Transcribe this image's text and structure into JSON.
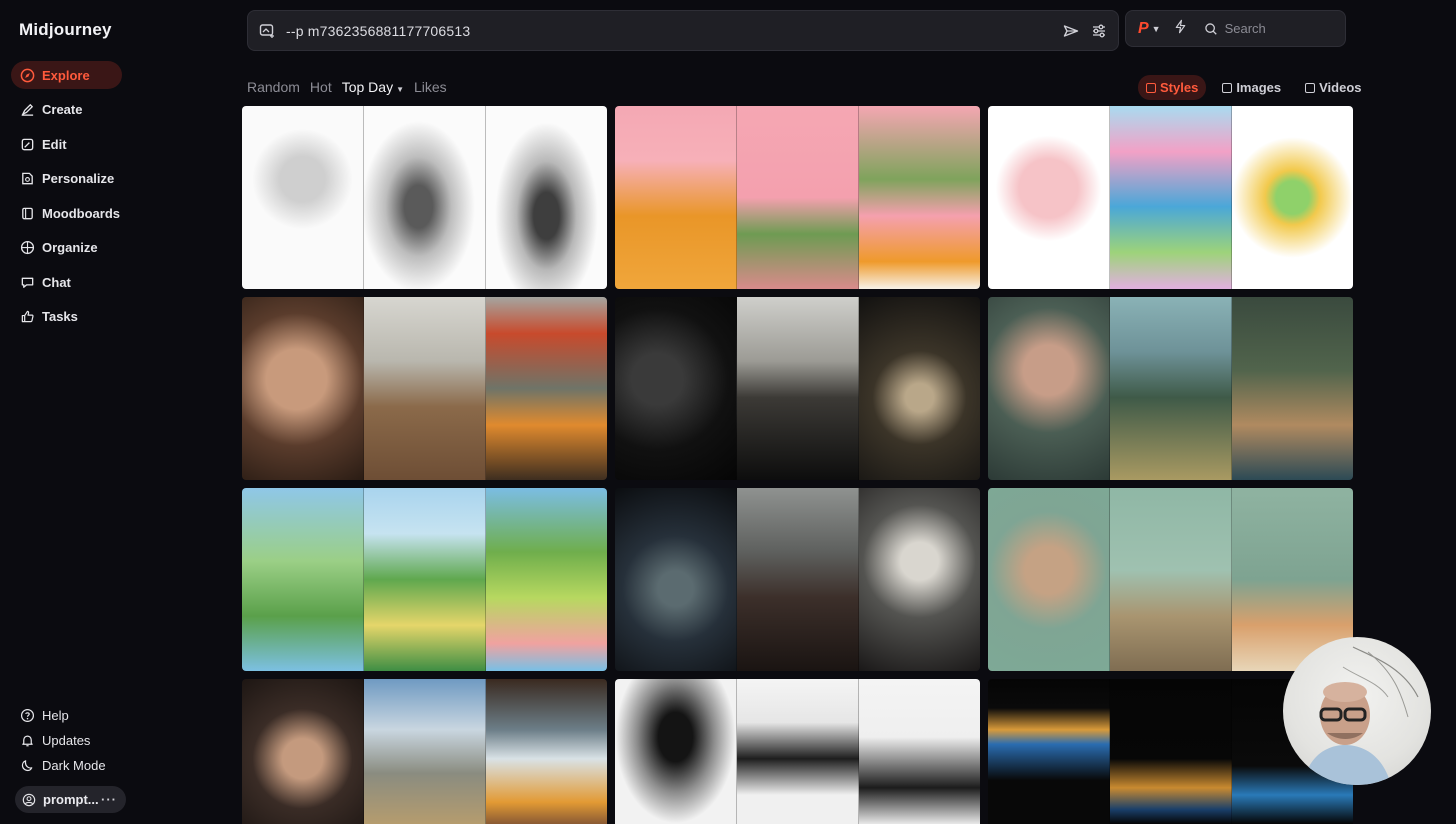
{
  "app": {
    "brand": "Midjourney"
  },
  "sidebar": {
    "items": [
      {
        "label": "Explore",
        "icon": "compass-icon",
        "active": true
      },
      {
        "label": "Create",
        "icon": "brush-icon"
      },
      {
        "label": "Edit",
        "icon": "edit-icon"
      },
      {
        "label": "Personalize",
        "icon": "personalize-icon"
      },
      {
        "label": "Moodboards",
        "icon": "moodboard-icon"
      },
      {
        "label": "Organize",
        "icon": "grid-icon"
      },
      {
        "label": "Chat",
        "icon": "chat-icon"
      },
      {
        "label": "Tasks",
        "icon": "thumbs-up-icon"
      }
    ],
    "bottom": [
      {
        "label": "Help",
        "icon": "help-icon"
      },
      {
        "label": "Updates",
        "icon": "bell-icon"
      },
      {
        "label": "Dark Mode",
        "icon": "moon-icon"
      }
    ],
    "profile": {
      "label": "prompt...",
      "more": "···"
    }
  },
  "prompt": {
    "value": "--p m7362356881177706513"
  },
  "search": {
    "placeholder": "Search"
  },
  "filters": {
    "items": [
      "Random",
      "Hot",
      "Top Day",
      "Likes"
    ],
    "active": "Top Day"
  },
  "views": {
    "items": [
      "Styles",
      "Images",
      "Videos"
    ],
    "active": "Styles"
  },
  "colors": {
    "accent": "#ff5a3c",
    "accent_bg": "#3a1616",
    "background": "#0b0b10",
    "panel": "#1f1f25"
  }
}
